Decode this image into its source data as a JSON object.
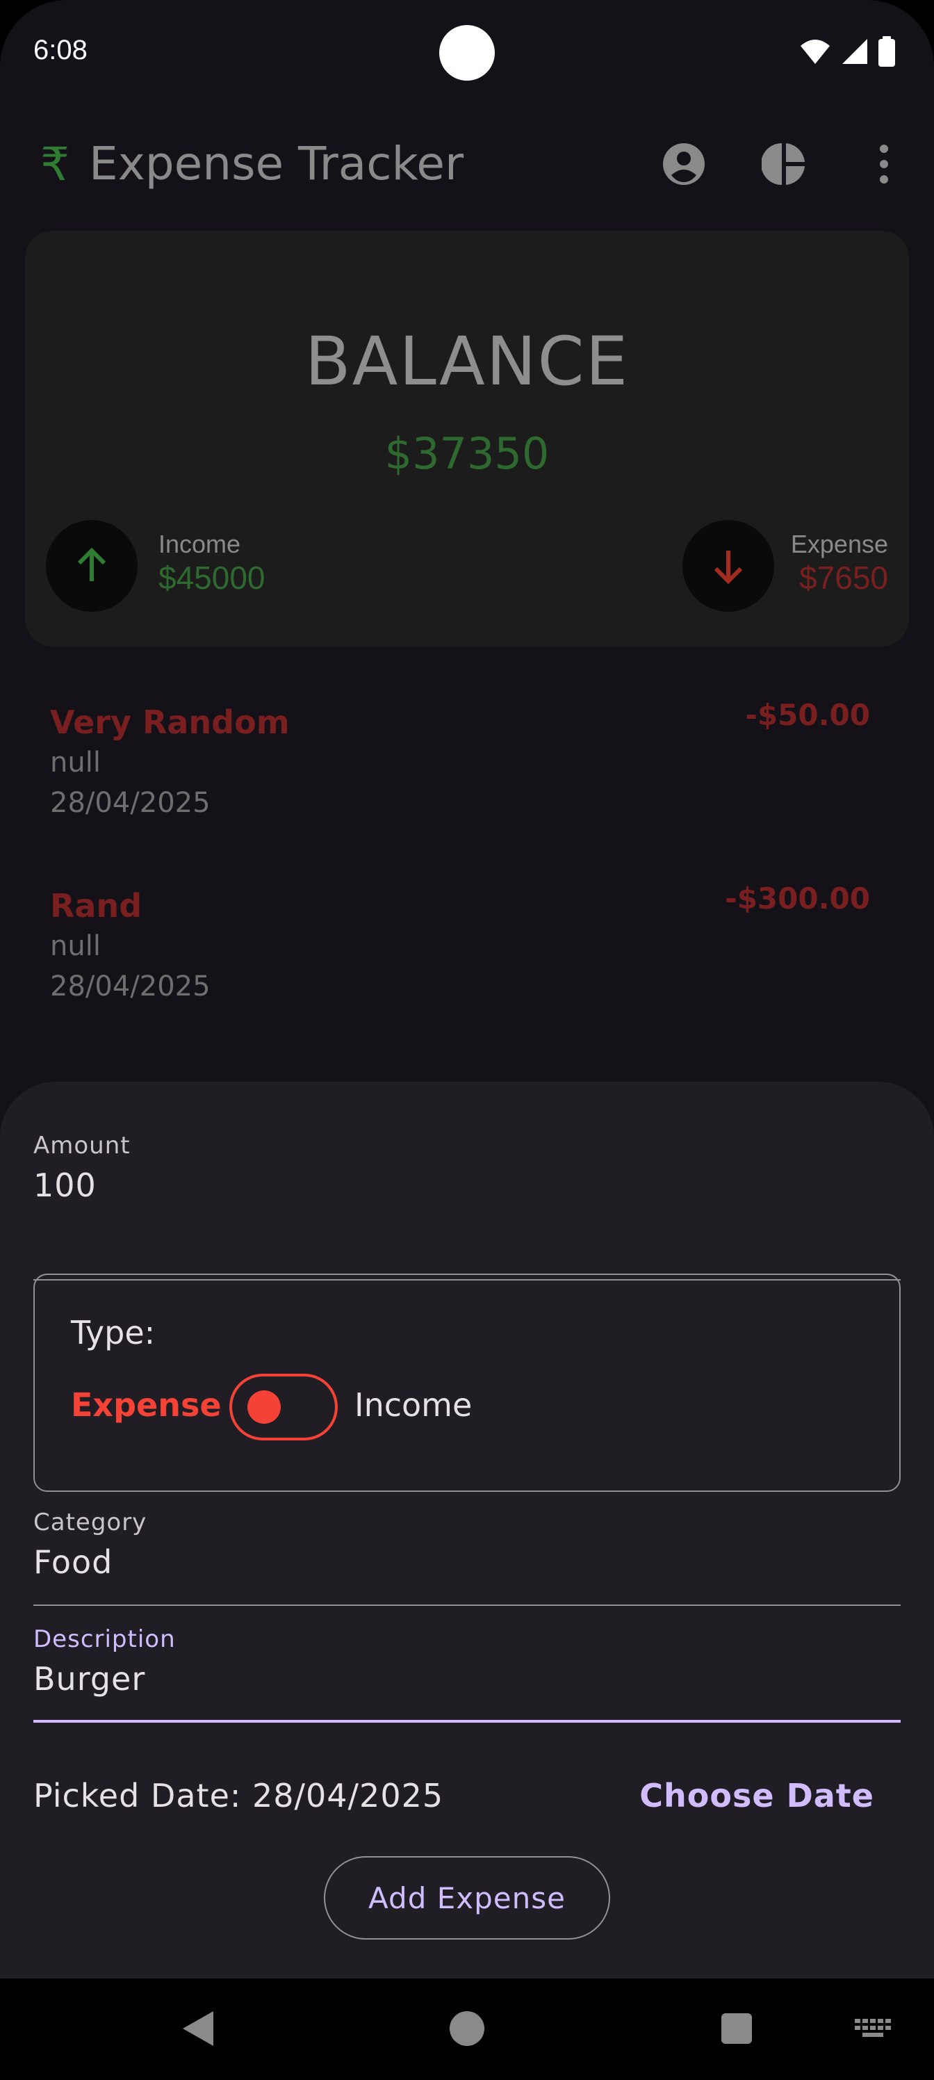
{
  "status_bar": {
    "time": "6:08"
  },
  "app_bar": {
    "logo_glyph": "₹",
    "title": "Expense Tracker",
    "icons": [
      "account-icon",
      "pie-chart-icon",
      "more-vert-icon"
    ]
  },
  "balance": {
    "label": "BALANCE",
    "value": "$37350",
    "income_label": "Income",
    "income_value": "$45000",
    "expense_label": "Expense",
    "expense_value": "$7650"
  },
  "transactions": [
    {
      "title": "Very Random",
      "desc": "null",
      "date": "28/04/2025",
      "amount": "-$50.00"
    },
    {
      "title": "Rand",
      "desc": "null",
      "date": "28/04/2025",
      "amount": "-$300.00"
    }
  ],
  "form": {
    "amount_label": "Amount",
    "amount_value": "100",
    "type_label": "Type:",
    "type_expense": "Expense",
    "type_income": "Income",
    "category_label": "Category",
    "category_value": "Food",
    "description_label": "Description",
    "description_value": "Burger",
    "picked_date": "Picked Date: 28/04/2025",
    "choose_date": "Choose Date",
    "submit": "Add Expense"
  },
  "colors": {
    "income": "#2e7d32",
    "expense": "#f44336",
    "accent": "#d0bcff"
  }
}
